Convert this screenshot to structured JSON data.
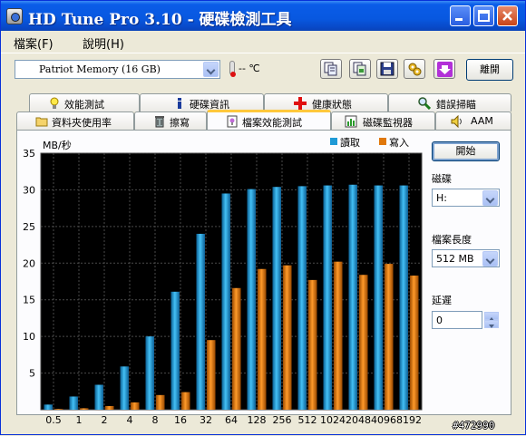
{
  "window": {
    "title": "HD Tune Pro 3.10 - 硬碟檢測工具"
  },
  "menu": {
    "file": "檔案(F)",
    "help": "說明(H)"
  },
  "toolbar": {
    "drive": "Patriot Memory (16 GB)",
    "temperature": "-- ℃",
    "exit_label": "離開"
  },
  "tabs_row1": [
    {
      "label": "效能測試",
      "icon": "lightbulb-icon"
    },
    {
      "label": "硬碟資訊",
      "icon": "info-icon"
    },
    {
      "label": "健康狀態",
      "icon": "health-cross-icon"
    },
    {
      "label": "錯誤掃瞄",
      "icon": "magnifier-icon"
    }
  ],
  "tabs_row2": [
    {
      "label": "資料夾使用率",
      "icon": "folder-icon"
    },
    {
      "label": "擦寫",
      "icon": "trash-icon"
    },
    {
      "label": "檔案效能測試",
      "icon": "file-benchmark-icon",
      "active": true
    },
    {
      "label": "磁碟監視器",
      "icon": "monitor-chart-icon"
    },
    {
      "label": "AAM",
      "icon": "speaker-icon"
    }
  ],
  "side": {
    "start_label": "開始",
    "disk_label": "磁碟",
    "disk_value": "H:",
    "file_length_label": "檔案長度",
    "file_length_value": "512 MB",
    "delay_label": "延遲",
    "delay_value": "0"
  },
  "watermark": "#472990",
  "chart_data": {
    "type": "bar",
    "ylabel": "MB/秒",
    "ylim": [
      0,
      35
    ],
    "yticks": [
      5,
      10,
      15,
      20,
      25,
      30,
      35
    ],
    "categories": [
      "0.5",
      "1",
      "2",
      "4",
      "8",
      "16",
      "32",
      "64",
      "128",
      "256",
      "512",
      "1024",
      "2048",
      "4096",
      "8192"
    ],
    "legend_position": "top-right",
    "series": [
      {
        "name": "讀取",
        "color": "#1f9ad6",
        "values": [
          0.7,
          1.8,
          3.4,
          5.9,
          10.0,
          16.1,
          24.0,
          29.5,
          30.1,
          30.4,
          30.5,
          30.6,
          30.7,
          30.6,
          30.6
        ]
      },
      {
        "name": "寫入",
        "color": "#e0780c",
        "values": [
          0.1,
          0.2,
          0.5,
          1.0,
          2.0,
          2.4,
          9.5,
          16.6,
          19.2,
          19.7,
          17.7,
          20.2,
          18.4,
          19.9,
          18.3
        ]
      }
    ]
  }
}
